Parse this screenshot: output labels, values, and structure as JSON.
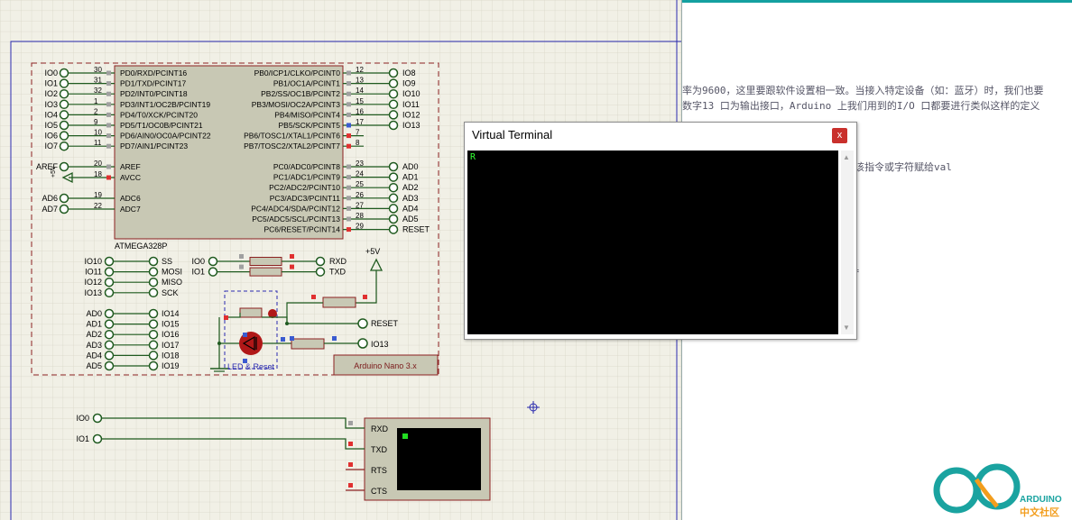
{
  "doc": {
    "line1": "率为9600，这里要跟软件设置相一致。当接入特定设备（如：蓝牙）时，我们也要",
    "line2": "数字13 口为输出接口，Arduino 上我们用到的I/O 口都要进行类似这样的定义",
    "line3": "将该指令或字符赋给val",
    "line4": "f"
  },
  "terminal": {
    "title": "Virtual Terminal",
    "close": "x",
    "content": "R"
  },
  "chip": {
    "name": "ATMEGA328P",
    "left_pins": [
      {
        "num": "30",
        "label": "PD0/RXD/PCINT16",
        "net": "IO0"
      },
      {
        "num": "31",
        "label": "PD1/TXD/PCINT17",
        "net": "IO1"
      },
      {
        "num": "32",
        "label": "PD2/INT0/PCINT18",
        "net": "IO2"
      },
      {
        "num": "1",
        "label": "PD3/INT1/OC2B/PCINT19",
        "net": "IO3"
      },
      {
        "num": "2",
        "label": "PD4/T0/XCK/PCINT20",
        "net": "IO4"
      },
      {
        "num": "9",
        "label": "PD5/T1/OC0B/PCINT21",
        "net": "IO5"
      },
      {
        "num": "10",
        "label": "PD6/AIN0/OC0A/PCINT22",
        "net": "IO6"
      },
      {
        "num": "11",
        "label": "PD7/AIN1/PCINT23",
        "net": "IO7"
      }
    ],
    "aref": {
      "num": "20",
      "label": "AREF",
      "net": "AREF"
    },
    "avcc": {
      "num": "18",
      "label": "AVCC",
      "net": "+5V"
    },
    "adc6": {
      "num": "19",
      "label": "ADC6",
      "net": "AD6"
    },
    "adc7": {
      "num": "22",
      "label": "ADC7",
      "net": "AD7"
    },
    "right_pins_b": [
      {
        "num": "12",
        "label": "PB0/ICP1/CLKO/PCINT0",
        "net": "IO8"
      },
      {
        "num": "13",
        "label": "PB1/OC1A/PCINT1",
        "net": "IO9"
      },
      {
        "num": "14",
        "label": "PB2/SS/OC1B/PCINT2",
        "net": "IO10"
      },
      {
        "num": "15",
        "label": "PB3/MOSI/OC2A/PCINT3",
        "net": "IO11"
      },
      {
        "num": "16",
        "label": "PB4/MISO/PCINT4",
        "net": "IO12"
      },
      {
        "num": "17",
        "label": "PB5/SCK/PCINT5",
        "net": "IO13"
      },
      {
        "num": "7",
        "label": "PB6/TOSC1/XTAL1/PCINT6",
        "net": ""
      },
      {
        "num": "8",
        "label": "PB7/TOSC2/XTAL2/PCINT7",
        "net": ""
      }
    ],
    "right_pins_c": [
      {
        "num": "23",
        "label": "PC0/ADC0/PCINT8",
        "net": "AD0"
      },
      {
        "num": "24",
        "label": "PC1/ADC1/PCINT9",
        "net": "AD1"
      },
      {
        "num": "25",
        "label": "PC2/ADC2/PCINT10",
        "net": "AD2"
      },
      {
        "num": "26",
        "label": "PC3/ADC3/PCINT11",
        "net": "AD3"
      },
      {
        "num": "27",
        "label": "PC4/ADC4/SDA/PCINT12",
        "net": "AD4"
      },
      {
        "num": "28",
        "label": "PC5/ADC5/SCL/PCINT13",
        "net": "AD5"
      },
      {
        "num": "29",
        "label": "PC6/RESET/PCINT14",
        "net": "RESET"
      }
    ]
  },
  "spi": [
    {
      "left": "IO10",
      "right": "SS"
    },
    {
      "left": "IO11",
      "right": "MOSI"
    },
    {
      "left": "IO12",
      "right": "MISO"
    },
    {
      "left": "IO13",
      "right": "SCK"
    }
  ],
  "uart": [
    {
      "left": "IO0",
      "right": "RXD"
    },
    {
      "left": "IO1",
      "right": "TXD"
    }
  ],
  "analog": [
    {
      "left": "AD0",
      "right": "IO14"
    },
    {
      "left": "AD1",
      "right": "IO15"
    },
    {
      "left": "AD2",
      "right": "IO16"
    },
    {
      "left": "AD3",
      "right": "IO17"
    },
    {
      "left": "AD4",
      "right": "IO18"
    },
    {
      "left": "AD5",
      "right": "IO19"
    }
  ],
  "power_label": "+5V",
  "avcc_supply": "+5V",
  "reset_net": "RESET",
  "led_net": "IO13",
  "led_block_label": "LED & Reset",
  "board_label": "Arduino Nano 3.x",
  "vt_component": {
    "in_left": [
      "IO0",
      "IO1"
    ],
    "pins": [
      "RXD",
      "TXD",
      "RTS",
      "CTS"
    ]
  },
  "logo": {
    "brand": "ARDUINO",
    "sub": "中文社区"
  },
  "colors": {
    "grid_bg": "#f1f0e6",
    "grid_line": "#d8d6c8",
    "wire": "#1f5a1f",
    "chip_fill": "#c8c8b4",
    "chip_border": "#8b2020",
    "frame": "#2a2ab0",
    "logo_teal": "#1aa3a0",
    "logo_orange": "#f29d1d"
  }
}
